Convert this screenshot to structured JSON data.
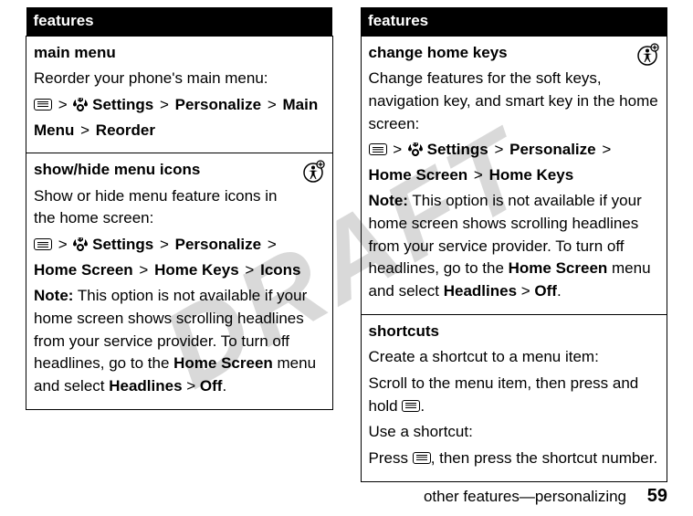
{
  "watermark": "DRAFT",
  "left_header": "features",
  "right_header": "features",
  "left": [
    {
      "title": "main menu",
      "intro": "Reorder your phone's main menu:",
      "path_parts": [
        "Settings",
        "Personalize",
        "Main Menu",
        "Reorder"
      ],
      "note": null,
      "badge": false
    },
    {
      "title": "show/hide menu icons",
      "intro": "Show or hide menu feature icons in the home screen:",
      "path_parts": [
        "Settings",
        "Personalize",
        "Home Screen",
        "Home Keys",
        "Icons"
      ],
      "note_pre": "Note:",
      "note": " This option is not available if your home screen shows scrolling headlines from your service provider. To turn off headlines, go to the ",
      "note_bold1": "Home Screen",
      "note_mid": " menu and select ",
      "note_bold2": "Headlines",
      "note_gt": " > ",
      "note_bold3": "Off",
      "note_end": ".",
      "badge": true
    }
  ],
  "right": [
    {
      "title": "change home keys",
      "intro": "Change features for the soft keys, navigation key, and smart key in the home screen:",
      "path_parts": [
        "Settings",
        "Personalize",
        "Home Screen",
        "Home Keys"
      ],
      "note_pre": "Note:",
      "note": " This option is not available if your home screen shows scrolling headlines from your service provider. To turn off headlines, go to the ",
      "note_bold1": "Home Screen",
      "note_mid": " menu and select ",
      "note_bold2": "Headlines",
      "note_gt": " > ",
      "note_bold3": "Off",
      "note_end": ".",
      "badge": true
    },
    {
      "title": "shortcuts",
      "create_intro": "Create a shortcut to a menu item:",
      "create_body_pre": "Scroll to the menu item, then press and hold ",
      "create_body_post": ".",
      "use_intro": "Use a shortcut:",
      "use_body_pre": "Press ",
      "use_body_post": ", then press the shortcut number."
    }
  ],
  "footer_text": "other features—personalizing",
  "page_number": "59"
}
